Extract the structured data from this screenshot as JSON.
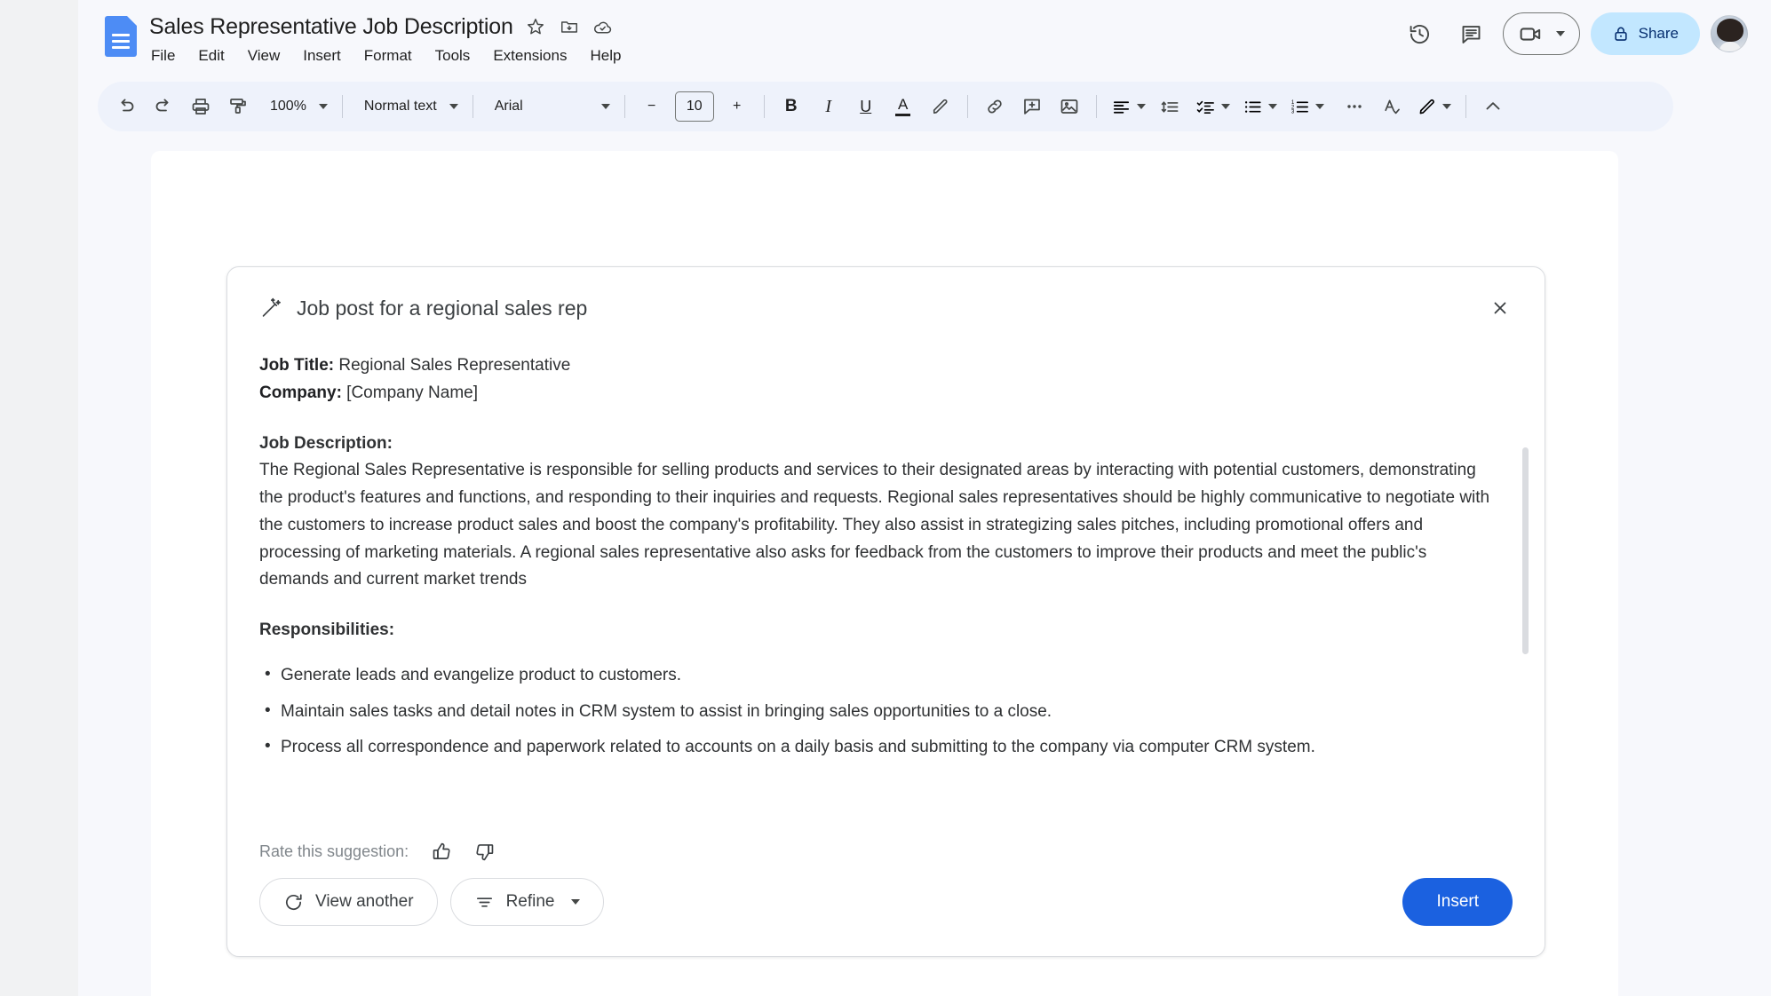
{
  "header": {
    "doc_icon": "google-docs-icon",
    "title": "Sales Representative Job Description",
    "title_actions": [
      {
        "name": "star-icon",
        "label": "Star"
      },
      {
        "name": "move-to-folder-icon",
        "label": "Move"
      },
      {
        "name": "cloud-saved-icon",
        "label": "Saved to Drive"
      }
    ],
    "menus": [
      "File",
      "Edit",
      "View",
      "Insert",
      "Format",
      "Tools",
      "Extensions",
      "Help"
    ],
    "right_actions": [
      {
        "name": "version-history-icon",
        "label": "Last edit"
      },
      {
        "name": "comment-icon",
        "label": "Open comment history"
      }
    ],
    "meet_label": "",
    "share_label": "Share",
    "share_bg": "#c2e7ff",
    "share_fg": "#062e6f",
    "avatar_label": "Account"
  },
  "toolbar": {
    "undo": "undo-icon",
    "redo": "redo-icon",
    "print": "print-icon",
    "paint_format": "paint-format-icon",
    "zoom_value": "100%",
    "style_value": "Normal text",
    "font_value": "Arial",
    "font_size_decrease": "−",
    "font_size_value": "10",
    "font_size_increase": "+",
    "bold": "B",
    "italic": "I",
    "underline": "U",
    "text_color": "A",
    "highlight": "highlighter-icon",
    "link": "link-icon",
    "comment": "add-comment-icon",
    "image": "insert-image-icon",
    "align": "align-left-icon",
    "line_spacing": "line-spacing-icon",
    "checklist": "checklist-icon",
    "bulleted_list": "bulleted-list-icon",
    "numbered_list": "numbered-list-icon",
    "more": "more-options-icon",
    "spelling": "spelling-check-icon",
    "editing_mode": "editing-mode-pencil-icon",
    "collapse": "hide-menus-chevron-icon"
  },
  "dialog": {
    "icon": "magic-wand-icon",
    "title": "Job post for a regional sales rep",
    "close_label": "×",
    "content": {
      "job_title_label": "Job Title:",
      "job_title_value": " Regional Sales Representative",
      "company_label": "Company:",
      "company_value": " [Company Name]",
      "description_label": "Job Description:",
      "description_body": "The Regional Sales Representative is responsible for selling products and services to their designated areas by interacting with potential customers, demonstrating the product's features and functions, and responding to their inquiries and requests. Regional sales representatives should be highly communicative to negotiate with the customers to increase product sales and boost the company's profitability. They also assist in strategizing sales pitches, including promotional offers and processing of marketing materials. A regional sales representative also asks for feedback from the customers to improve their products and meet the public's demands and current market trends",
      "responsibilities_label": "Responsibilities:",
      "responsibilities": [
        "Generate leads and evangelize product to customers.",
        "Maintain sales tasks and detail notes in CRM system to assist in bringing sales opportunities to a close.",
        "Process all correspondence and paperwork related to accounts on a daily basis and submitting to the company via computer CRM system."
      ]
    },
    "rate_label": "Rate this suggestion:",
    "thumb_up": "thumb-up-icon",
    "thumb_down": "thumb-down-icon",
    "view_another_label": "View another",
    "refine_label": "Refine",
    "insert_label": "Insert",
    "insert_bg": "#1b61e0"
  }
}
